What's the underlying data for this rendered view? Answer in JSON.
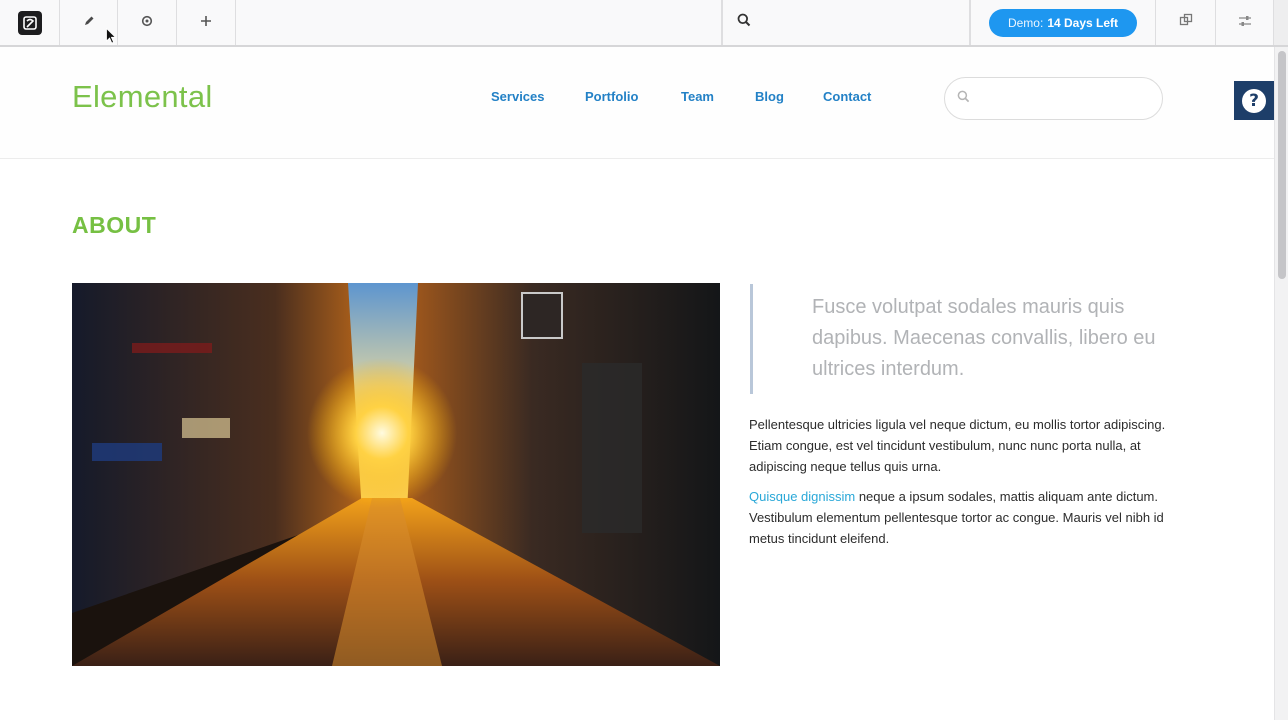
{
  "editor_toolbar": {
    "search_icon": "search-icon",
    "demo_badge": {
      "prefix": "Demo:",
      "highlight": "14 Days Left",
      "color": "#1e97f0"
    },
    "icons": [
      "app-logo-icon",
      "pencil-icon",
      "gear-icon",
      "plus-icon",
      "search-icon",
      "layers-icon",
      "sliders-icon"
    ]
  },
  "site": {
    "brand": "Elemental",
    "brand_color": "#7cc24b",
    "nav": [
      "Services",
      "Portfolio",
      "Team",
      "Blog",
      "Contact"
    ],
    "search_placeholder": "",
    "help_label": "?"
  },
  "about": {
    "heading": "ABOUT",
    "quote": "Fusce volutpat sodales mauris quis dapibus. Maecenas convallis, libero eu ultrices interdum.",
    "paragraph1": "Pellentesque ultricies ligula vel neque dictum, eu mollis tortor adipiscing. Etiam congue, est vel tincidunt vestibulum, nunc nunc porta nulla, at adipiscing neque tellus quis urna.",
    "paragraph2_link": "Quisque dignissim",
    "paragraph2_rest": " neque a ipsum sodales, mattis aliquam ante dictum. Vestibulum elementum pellentesque tortor ac congue. Mauris vel nibh id metus tincidunt eleifend."
  }
}
